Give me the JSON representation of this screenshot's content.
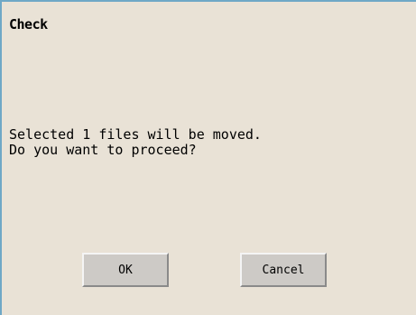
{
  "dialog": {
    "title": "Check",
    "message_line1": "Selected 1 files will be moved.",
    "message_line2": "Do you want to proceed?",
    "ok_label": "OK",
    "cancel_label": "Cancel"
  },
  "colors": {
    "background": "#e9e2d6",
    "border_accent": "#6fa8c6",
    "button_face": "#cdcac6"
  }
}
